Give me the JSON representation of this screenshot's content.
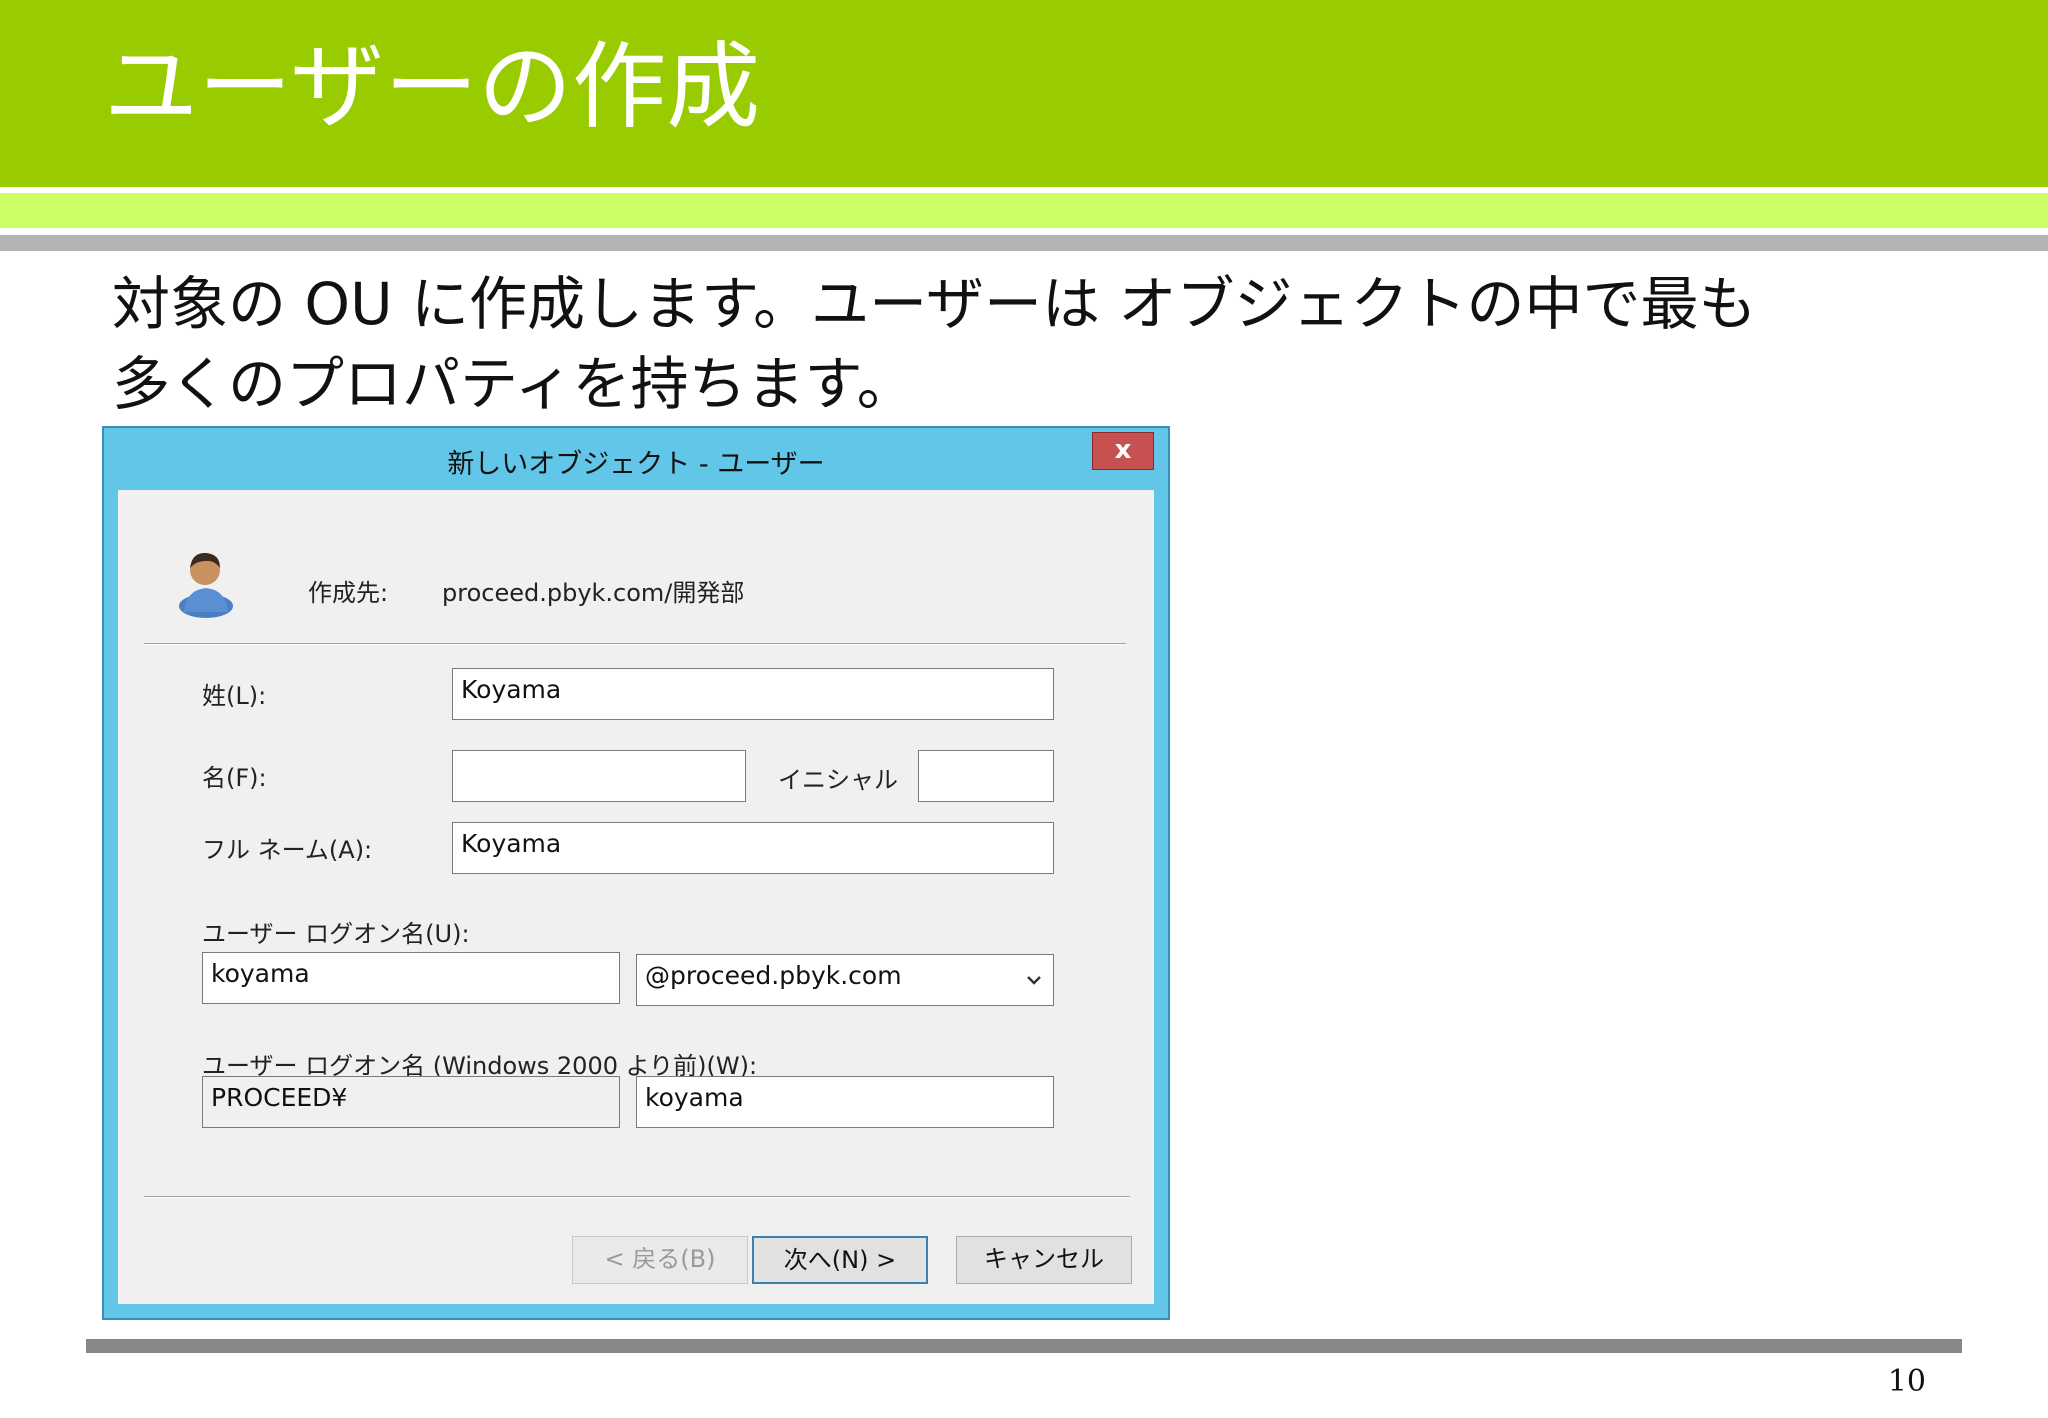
{
  "slide": {
    "title": "ユーザーの作成",
    "body_lines": [
      "対象の OU に作成します。ユーザーは オブジェクトの中で最も",
      "多くのプロパティを持ちます。"
    ],
    "page_number": "10"
  },
  "dialog": {
    "title": "新しいオブジェクト - ユーザー",
    "close_label": "x",
    "create_in_label": "作成先:",
    "create_in_value": "proceed.pbyk.com/開発部",
    "last_name_label": "姓(L):",
    "last_name_value": "Koyama",
    "first_name_label": "名(F):",
    "first_name_value": "",
    "initials_label": "イニシャル",
    "initials_value": "",
    "full_name_label": "フル ネーム(A):",
    "full_name_value": "Koyama",
    "logon_name_label": "ユーザー ログオン名(U):",
    "logon_name_value": "koyama",
    "upn_suffix_value": "@proceed.pbyk.com",
    "pre2000_label": "ユーザー ログオン名 (Windows 2000 より前)(W):",
    "pre2000_domain_value": "PROCEED¥",
    "pre2000_name_value": "koyama",
    "back_label": "< 戻る(B)",
    "next_label": "次へ(N) >",
    "cancel_label": "キャンセル"
  },
  "icons": {
    "user": "user-icon",
    "dropdown": "chevron-down-icon"
  }
}
